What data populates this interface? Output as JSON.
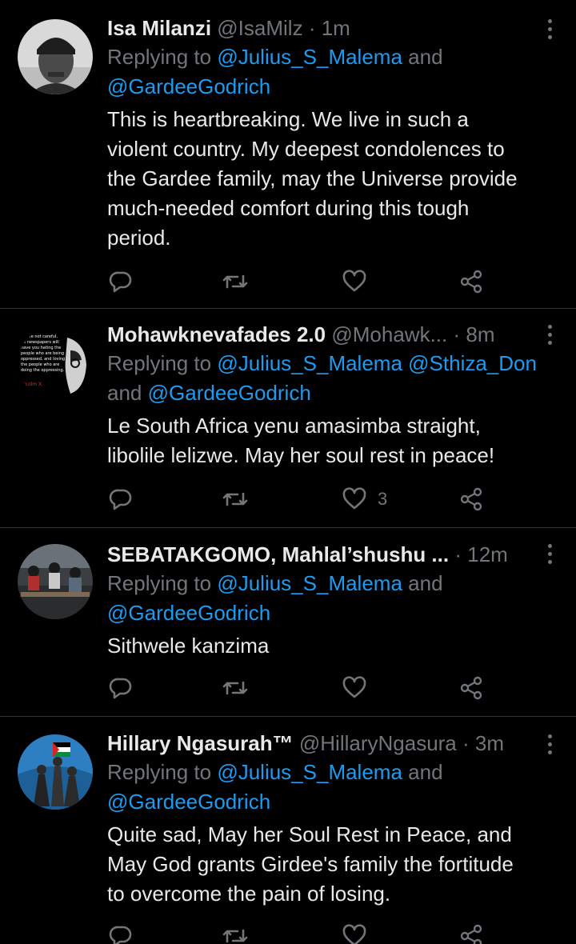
{
  "tweets": [
    {
      "display_name": "Isa Milanzi",
      "handle": "@IsaMilz",
      "sep": "·",
      "time": "1m",
      "reply_prefix": "Replying to",
      "reply_mention_1": "@Julius_S_Malema",
      "reply_and": "and",
      "reply_mention_2": "@GardeeGodrich",
      "text_lines": [
        "This is heartbreaking. We live in such a",
        "violent country. My deepest condolences to",
        "the Gardee family, may the Universe provide",
        "much-needed comfort during this tough",
        "period."
      ],
      "like_count": ""
    },
    {
      "display_name": "Mohawknevafades 2.0",
      "handle": "@Mohawk...",
      "sep": "·",
      "time": "8m",
      "reply_prefix": "Replying to",
      "reply_mention_1": "@Julius_S_Malema",
      "reply_mention_2": "@Sthiza_Don",
      "reply_and": "and",
      "reply_mention_3": "@GardeeGodrich",
      "text_lines": [
        "Le South Africa yenu amasimba straight,",
        "libolile lelizwe. May her soul rest in peace!"
      ],
      "like_count": "3",
      "avatar_text": [
        "..ou're not careful,",
        "..e newspapers will",
        "have you hating the",
        "people who are being",
        "oppressed, and loving",
        "the people who are",
        "doing the oppressing.",
        "'colm X"
      ]
    },
    {
      "display_name": "SEBATAKGOMO, Mahlal’shushu ...",
      "handle": "",
      "sep": "·",
      "time": "12m",
      "reply_prefix": "Replying to",
      "reply_mention_1": "@Julius_S_Malema",
      "reply_and": "and",
      "reply_mention_2": "@GardeeGodrich",
      "text_lines": [
        "Sithwele kanzima"
      ],
      "like_count": ""
    },
    {
      "display_name": "Hillary Ngasurah™",
      "handle": "@HillaryNgasura",
      "sep": "·",
      "time": "3m",
      "reply_prefix": "Replying to",
      "reply_mention_1": "@Julius_S_Malema",
      "reply_and": "and",
      "reply_mention_2": "@GardeeGodrich",
      "text_lines": [
        "Quite sad, May her Soul Rest in Peace, and",
        "May God grants Girdee's family the fortitude",
        "to overcome the pain of losing."
      ],
      "like_count": ""
    }
  ],
  "icons": {
    "reply": "reply-icon",
    "retweet": "retweet-icon",
    "like": "like-icon",
    "share": "share-icon",
    "more": "more-icon"
  },
  "colors": {
    "background": "#000000",
    "text": "#e7e9ea",
    "muted": "#71767b",
    "mention": "#1d9bf0",
    "divider": "#2f3336"
  }
}
